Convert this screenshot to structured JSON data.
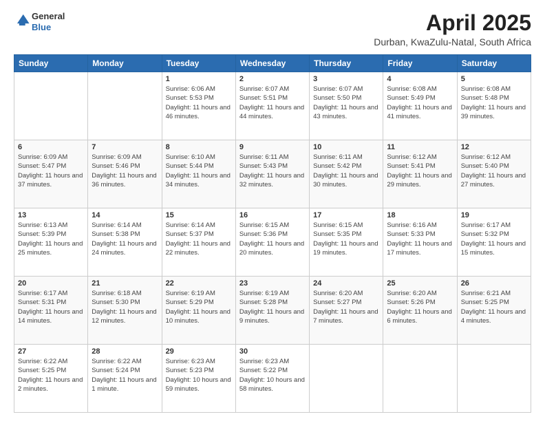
{
  "header": {
    "logo_line1": "General",
    "logo_line2": "Blue",
    "title": "April 2025",
    "subtitle": "Durban, KwaZulu-Natal, South Africa"
  },
  "days_of_week": [
    "Sunday",
    "Monday",
    "Tuesday",
    "Wednesday",
    "Thursday",
    "Friday",
    "Saturday"
  ],
  "weeks": [
    [
      {
        "day": "",
        "info": ""
      },
      {
        "day": "",
        "info": ""
      },
      {
        "day": "1",
        "info": "Sunrise: 6:06 AM\nSunset: 5:53 PM\nDaylight: 11 hours and 46 minutes."
      },
      {
        "day": "2",
        "info": "Sunrise: 6:07 AM\nSunset: 5:51 PM\nDaylight: 11 hours and 44 minutes."
      },
      {
        "day": "3",
        "info": "Sunrise: 6:07 AM\nSunset: 5:50 PM\nDaylight: 11 hours and 43 minutes."
      },
      {
        "day": "4",
        "info": "Sunrise: 6:08 AM\nSunset: 5:49 PM\nDaylight: 11 hours and 41 minutes."
      },
      {
        "day": "5",
        "info": "Sunrise: 6:08 AM\nSunset: 5:48 PM\nDaylight: 11 hours and 39 minutes."
      }
    ],
    [
      {
        "day": "6",
        "info": "Sunrise: 6:09 AM\nSunset: 5:47 PM\nDaylight: 11 hours and 37 minutes."
      },
      {
        "day": "7",
        "info": "Sunrise: 6:09 AM\nSunset: 5:46 PM\nDaylight: 11 hours and 36 minutes."
      },
      {
        "day": "8",
        "info": "Sunrise: 6:10 AM\nSunset: 5:44 PM\nDaylight: 11 hours and 34 minutes."
      },
      {
        "day": "9",
        "info": "Sunrise: 6:11 AM\nSunset: 5:43 PM\nDaylight: 11 hours and 32 minutes."
      },
      {
        "day": "10",
        "info": "Sunrise: 6:11 AM\nSunset: 5:42 PM\nDaylight: 11 hours and 30 minutes."
      },
      {
        "day": "11",
        "info": "Sunrise: 6:12 AM\nSunset: 5:41 PM\nDaylight: 11 hours and 29 minutes."
      },
      {
        "day": "12",
        "info": "Sunrise: 6:12 AM\nSunset: 5:40 PM\nDaylight: 11 hours and 27 minutes."
      }
    ],
    [
      {
        "day": "13",
        "info": "Sunrise: 6:13 AM\nSunset: 5:39 PM\nDaylight: 11 hours and 25 minutes."
      },
      {
        "day": "14",
        "info": "Sunrise: 6:14 AM\nSunset: 5:38 PM\nDaylight: 11 hours and 24 minutes."
      },
      {
        "day": "15",
        "info": "Sunrise: 6:14 AM\nSunset: 5:37 PM\nDaylight: 11 hours and 22 minutes."
      },
      {
        "day": "16",
        "info": "Sunrise: 6:15 AM\nSunset: 5:36 PM\nDaylight: 11 hours and 20 minutes."
      },
      {
        "day": "17",
        "info": "Sunrise: 6:15 AM\nSunset: 5:35 PM\nDaylight: 11 hours and 19 minutes."
      },
      {
        "day": "18",
        "info": "Sunrise: 6:16 AM\nSunset: 5:33 PM\nDaylight: 11 hours and 17 minutes."
      },
      {
        "day": "19",
        "info": "Sunrise: 6:17 AM\nSunset: 5:32 PM\nDaylight: 11 hours and 15 minutes."
      }
    ],
    [
      {
        "day": "20",
        "info": "Sunrise: 6:17 AM\nSunset: 5:31 PM\nDaylight: 11 hours and 14 minutes."
      },
      {
        "day": "21",
        "info": "Sunrise: 6:18 AM\nSunset: 5:30 PM\nDaylight: 11 hours and 12 minutes."
      },
      {
        "day": "22",
        "info": "Sunrise: 6:19 AM\nSunset: 5:29 PM\nDaylight: 11 hours and 10 minutes."
      },
      {
        "day": "23",
        "info": "Sunrise: 6:19 AM\nSunset: 5:28 PM\nDaylight: 11 hours and 9 minutes."
      },
      {
        "day": "24",
        "info": "Sunrise: 6:20 AM\nSunset: 5:27 PM\nDaylight: 11 hours and 7 minutes."
      },
      {
        "day": "25",
        "info": "Sunrise: 6:20 AM\nSunset: 5:26 PM\nDaylight: 11 hours and 6 minutes."
      },
      {
        "day": "26",
        "info": "Sunrise: 6:21 AM\nSunset: 5:25 PM\nDaylight: 11 hours and 4 minutes."
      }
    ],
    [
      {
        "day": "27",
        "info": "Sunrise: 6:22 AM\nSunset: 5:25 PM\nDaylight: 11 hours and 2 minutes."
      },
      {
        "day": "28",
        "info": "Sunrise: 6:22 AM\nSunset: 5:24 PM\nDaylight: 11 hours and 1 minute."
      },
      {
        "day": "29",
        "info": "Sunrise: 6:23 AM\nSunset: 5:23 PM\nDaylight: 10 hours and 59 minutes."
      },
      {
        "day": "30",
        "info": "Sunrise: 6:23 AM\nSunset: 5:22 PM\nDaylight: 10 hours and 58 minutes."
      },
      {
        "day": "",
        "info": ""
      },
      {
        "day": "",
        "info": ""
      },
      {
        "day": "",
        "info": ""
      }
    ]
  ]
}
